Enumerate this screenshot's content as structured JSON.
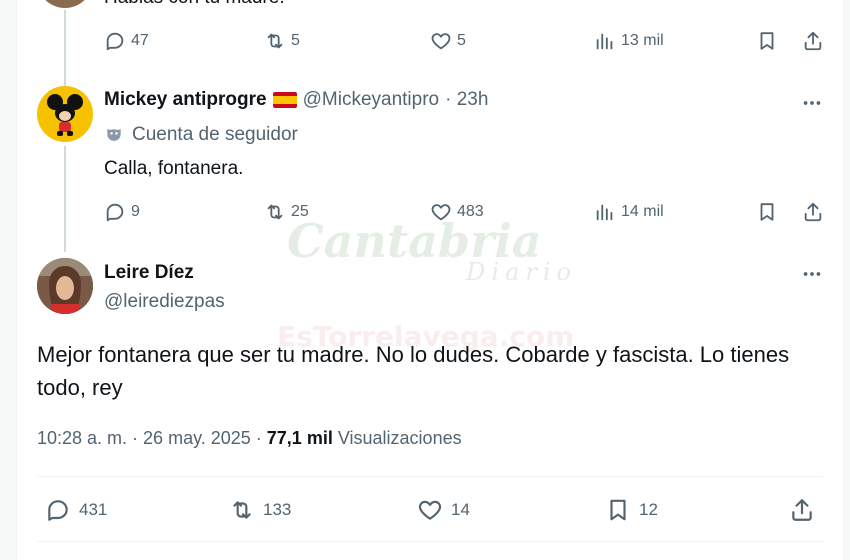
{
  "tweet_prev": {
    "text_partial": "Hablas con tu madre.",
    "replies": "47",
    "retweets": "5",
    "likes": "5",
    "views": "13 mil"
  },
  "tweet_mickey": {
    "name": "Mickey antiprogre",
    "flag": "🇪🇸",
    "handle": "@Mickeyantipro",
    "time": "· 23h",
    "label": "Cuenta de seguidor",
    "text": "Calla, fontanera.",
    "replies": "9",
    "retweets": "25",
    "likes": "483",
    "views": "14 mil"
  },
  "tweet_main": {
    "name": "Leire Díez",
    "handle": "@leirediezpas",
    "text": "Mejor fontanera que ser tu madre. No lo dudes. Cobarde y fascista. Lo tienes todo, rey",
    "timestamp": "10:28 a. m. · 26 may. 2025 · ",
    "views_count": "77,1 mil",
    "views_label": "Visualizaciones",
    "replies": "431",
    "retweets": "133",
    "likes": "14",
    "bookmarks": "12"
  },
  "watermark": {
    "brand": "Cantabria",
    "brand_sub": "Diario",
    "site": "EsTorrelavega.com"
  },
  "colors": {
    "text_primary": "#0f1419",
    "text_secondary": "#536471",
    "thread_line": "#cfd9de"
  }
}
